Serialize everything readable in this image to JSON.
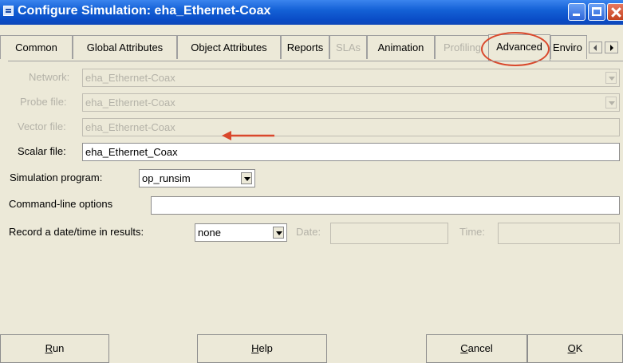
{
  "window": {
    "title": "Configure Simulation: eha_Ethernet-Coax"
  },
  "tabs": [
    {
      "label": "Common"
    },
    {
      "label": "Global Attributes"
    },
    {
      "label": "Object Attributes"
    },
    {
      "label": "Reports"
    },
    {
      "label": "SLAs"
    },
    {
      "label": "Animation"
    },
    {
      "label": "Profiling"
    },
    {
      "label": "Advanced"
    },
    {
      "label": "Enviro"
    }
  ],
  "form": {
    "network": {
      "label": "Network:",
      "value": "eha_Ethernet-Coax"
    },
    "probe_file": {
      "label": "Probe file:",
      "value": "eha_Ethernet-Coax"
    },
    "vector_file": {
      "label": "Vector file:",
      "value": "eha_Ethernet-Coax"
    },
    "scalar_file": {
      "label": "Scalar file:",
      "value": "eha_Ethernet_Coax"
    },
    "simulation_program": {
      "label": "Simulation program:",
      "value": "op_runsim"
    },
    "command_line": {
      "label": "Command-line options",
      "value": ""
    },
    "record_datetime": {
      "label": "Record a date/time in results:",
      "value": "none"
    },
    "date": {
      "label": "Date:",
      "value": ""
    },
    "time": {
      "label": "Time:",
      "value": ""
    }
  },
  "buttons": {
    "run": {
      "mnemonic": "R",
      "rest": "un"
    },
    "help": {
      "mnemonic": "H",
      "rest": "elp"
    },
    "cancel": {
      "mnemonic": "C",
      "rest": "ancel"
    },
    "ok": {
      "mnemonic": "O",
      "rest": "K"
    }
  },
  "colors": {
    "title_bar": "#0a4cc6",
    "highlight": "#d9482c",
    "window_bg": "#ece9d8",
    "disabled_text": "#b4b2a8"
  },
  "icons": {
    "app": "window-icon",
    "minimize": "minimize-icon",
    "maximize": "maximize-icon",
    "close": "close-icon"
  }
}
